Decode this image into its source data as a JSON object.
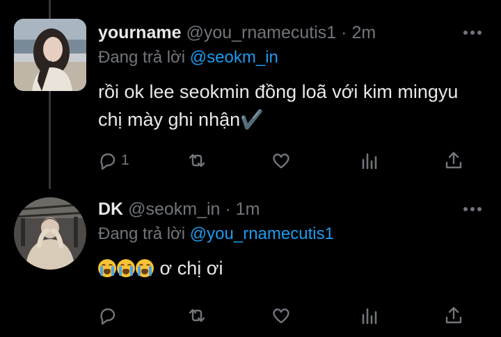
{
  "tweets": [
    {
      "name": "yourname",
      "handle": "@you_rnamecutis1",
      "dot": "·",
      "time": "2m",
      "reply_prefix": "Đang trả lời",
      "reply_to": "@seokm_in",
      "text": "rồi ok lee seokmin đồng loã với kim mingyu chị mày ghi nhận",
      "text_suffix": "✔️",
      "reply_count": "1"
    },
    {
      "name": "DK",
      "handle": "@seokm_in",
      "dot": "·",
      "time": "1m",
      "reply_prefix": "Đang trả lời",
      "reply_to": "@you_rnamecutis1",
      "text": "ơ chị ơi",
      "emoji": "😭😭😭",
      "reply_count": ""
    }
  ],
  "icons": [
    "reply-icon",
    "retweet-icon",
    "like-icon",
    "views-icon",
    "share-icon",
    "more-icon"
  ],
  "colors": {
    "background": "#000000",
    "text": "#e7e9ea",
    "muted": "#71767b",
    "mention": "#1d9bf0"
  }
}
